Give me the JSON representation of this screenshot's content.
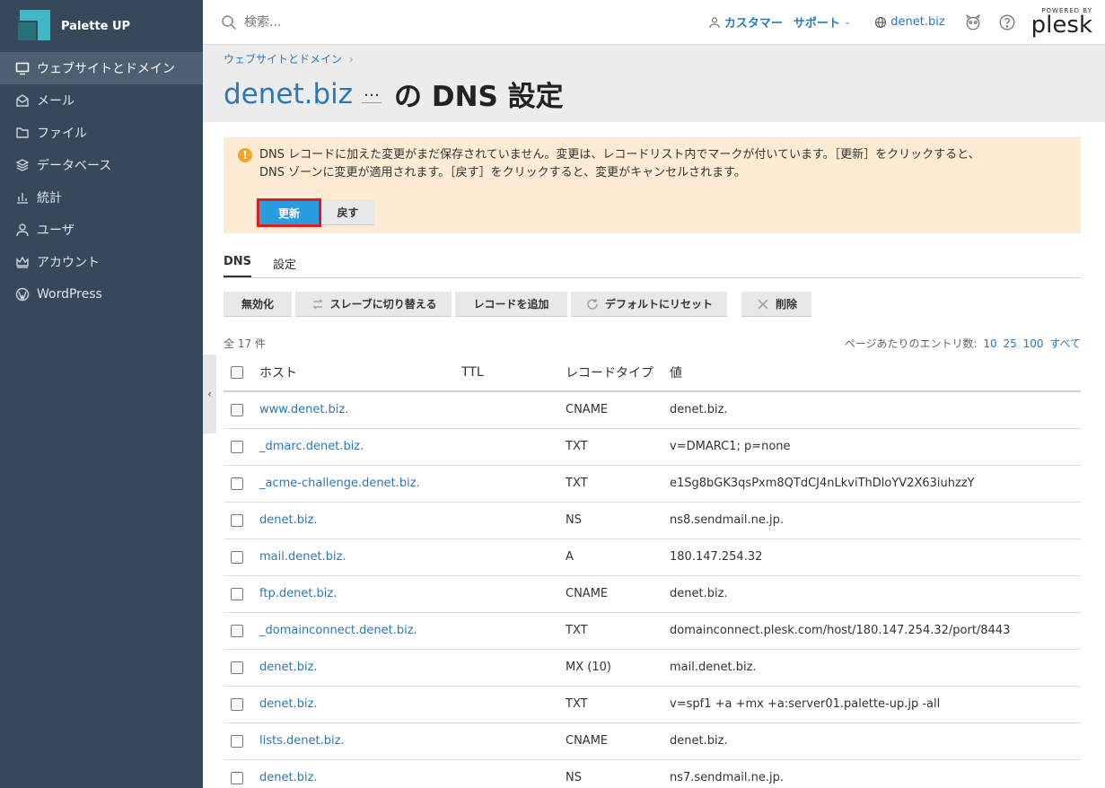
{
  "brand": {
    "name": "Palette UP"
  },
  "sidebar": {
    "items": [
      {
        "label": "ウェブサイトとドメイン",
        "icon": "monitor-icon",
        "active": true
      },
      {
        "label": "メール",
        "icon": "mail-icon"
      },
      {
        "label": "ファイル",
        "icon": "folder-icon"
      },
      {
        "label": "データベース",
        "icon": "database-icon"
      },
      {
        "label": "統計",
        "icon": "stats-icon"
      },
      {
        "label": "ユーザ",
        "icon": "user-icon"
      },
      {
        "label": "アカウント",
        "icon": "crown-icon"
      },
      {
        "label": "WordPress",
        "icon": "wordpress-icon"
      }
    ]
  },
  "topbar": {
    "search_placeholder": "検索...",
    "customer_label": "カスタマー",
    "support_label": "サポート",
    "domain_label": "denet.biz",
    "powered_by": "POWERED BY",
    "plesk_logo": "plesk"
  },
  "header": {
    "breadcrumb": "ウェブサイトとドメイン",
    "title_domain": "denet.biz",
    "title_more": "…",
    "title_rest": "の DNS 設定"
  },
  "alert": {
    "text_line1": "DNS レコードに加えた変更がまだ保存されていません。変更は、レコードリスト内でマークが付いています。［更新］をクリックすると、",
    "text_line2": "DNS ゾーンに変更が適用されます。［戻す］をクリックすると、変更がキャンセルされます。",
    "update_label": "更新",
    "revert_label": "戻す",
    "accent_color": "#f2a52a"
  },
  "tabs": [
    {
      "label": "DNS",
      "active": true
    },
    {
      "label": "設定",
      "active": false
    }
  ],
  "toolbar": {
    "disable_label": "無効化",
    "slave_label": "スレーブに切り替える",
    "add_label": "レコードを追加",
    "reset_label": "デフォルトにリセット",
    "delete_label": "削除"
  },
  "list": {
    "count_label": "全 17 件",
    "per_page_label": "ページあたりのエントリ数:",
    "per_page_options": [
      "10",
      "25",
      "100",
      "すべて"
    ]
  },
  "table": {
    "headers": {
      "host": "ホスト",
      "ttl": "TTL",
      "type": "レコードタイプ",
      "value": "値"
    },
    "rows": [
      {
        "host": "www.denet.biz.",
        "ttl": "",
        "type": "CNAME",
        "value": "denet.biz."
      },
      {
        "host": "_dmarc.denet.biz.",
        "ttl": "",
        "type": "TXT",
        "value": "v=DMARC1; p=none"
      },
      {
        "host": "_acme-challenge.denet.biz.",
        "ttl": "",
        "type": "TXT",
        "value": "e1Sg8bGK3qsPxm8QTdCJ4nLkviThDloYV2X63iuhzzY"
      },
      {
        "host": "denet.biz.",
        "ttl": "",
        "type": "NS",
        "value": "ns8.sendmail.ne.jp."
      },
      {
        "host": "mail.denet.biz.",
        "ttl": "",
        "type": "A",
        "value": "180.147.254.32"
      },
      {
        "host": "ftp.denet.biz.",
        "ttl": "",
        "type": "CNAME",
        "value": "denet.biz."
      },
      {
        "host": "_domainconnect.denet.biz.",
        "ttl": "",
        "type": "TXT",
        "value": "domainconnect.plesk.com/host/180.147.254.32/port/8443"
      },
      {
        "host": "denet.biz.",
        "ttl": "",
        "type": "MX (10)",
        "value": "mail.denet.biz."
      },
      {
        "host": "denet.biz.",
        "ttl": "",
        "type": "TXT",
        "value": "v=spf1 +a +mx +a:server01.palette-up.jp -all"
      },
      {
        "host": "lists.denet.biz.",
        "ttl": "",
        "type": "CNAME",
        "value": "denet.biz."
      },
      {
        "host": "denet.biz.",
        "ttl": "",
        "type": "NS",
        "value": "ns7.sendmail.ne.jp."
      }
    ]
  }
}
